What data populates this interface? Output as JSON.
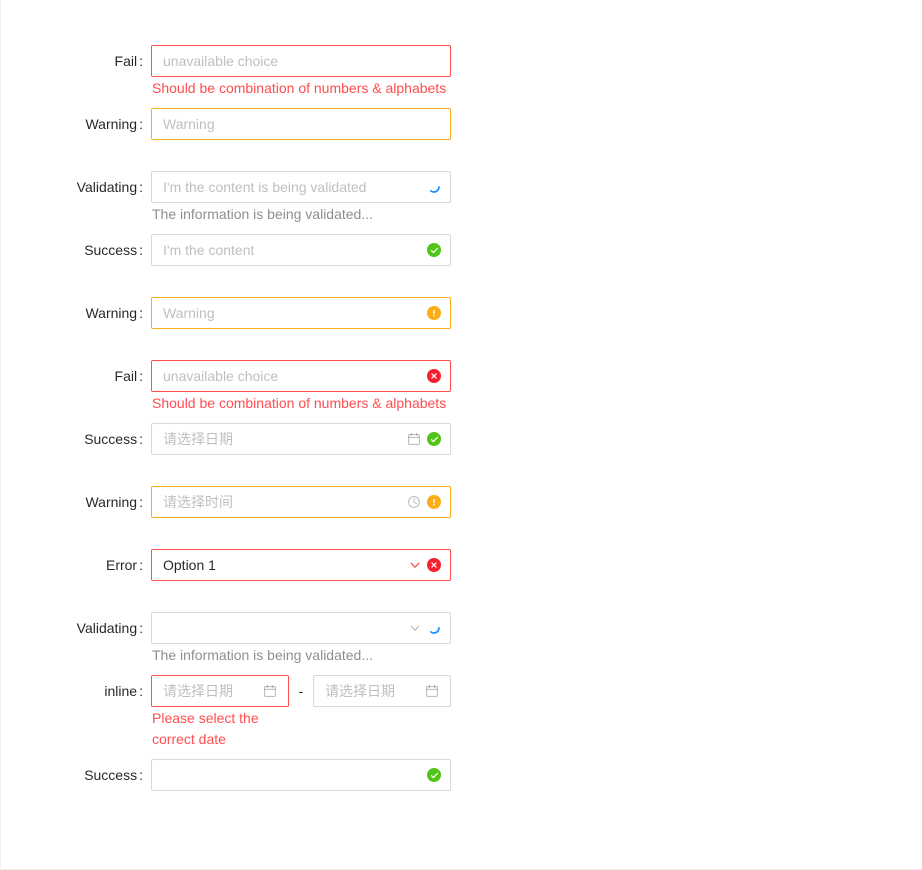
{
  "theme": {
    "error_color": "#ff4d4f",
    "error_icon_color": "#f5222d",
    "warning_color": "#faad14",
    "success_color": "#52c41a",
    "validating_color": "#1890ff",
    "border_color": "#d9d9d9",
    "placeholder_color": "#bfbfbf",
    "label_color": "rgba(0,0,0,0.85)",
    "help_color": "rgba(0,0,0,0.45)"
  },
  "form": {
    "rows": [
      {
        "id": "fail-input-plain",
        "label": "Fail",
        "colon": ":",
        "placeholder": "unavailable choice",
        "value": "",
        "status": "error",
        "help": "Should be combination of numbers & alphabets",
        "help_status": "error",
        "has_status_icon": false,
        "control": "input"
      },
      {
        "id": "warning-input-plain",
        "label": "Warning",
        "colon": ":",
        "placeholder": "Warning",
        "value": "",
        "status": "warning",
        "help": "",
        "has_status_icon": false,
        "control": "input"
      },
      {
        "id": "validating-input",
        "label": "Validating",
        "colon": ":",
        "placeholder": "I'm the content is being validated",
        "value": "",
        "status": "validating",
        "help": "The information is being validated...",
        "help_status": "normal",
        "has_status_icon": true,
        "status_icon": "loading-spinner-icon",
        "control": "input"
      },
      {
        "id": "success-input",
        "label": "Success",
        "colon": ":",
        "placeholder": "I'm the content",
        "value": "",
        "status": "success",
        "help": "",
        "has_status_icon": true,
        "status_icon": "check-circle-icon",
        "control": "input"
      },
      {
        "id": "warning-input-icon",
        "label": "Warning",
        "colon": ":",
        "placeholder": "Warning",
        "value": "",
        "status": "warning",
        "help": "",
        "has_status_icon": true,
        "status_icon": "exclamation-circle-icon",
        "control": "input"
      },
      {
        "id": "fail-input-icon",
        "label": "Fail",
        "colon": ":",
        "placeholder": "unavailable choice",
        "value": "",
        "status": "error",
        "help": "Should be combination of numbers & alphabets",
        "help_status": "error",
        "has_status_icon": true,
        "status_icon": "close-circle-icon",
        "control": "input"
      },
      {
        "id": "success-datepicker",
        "label": "Success",
        "colon": ":",
        "placeholder": "请选择日期",
        "value": "",
        "status": "success",
        "help": "",
        "has_status_icon": true,
        "status_icon": "check-circle-icon",
        "prefix_icon": "calendar-icon",
        "control": "datepicker"
      },
      {
        "id": "warning-timepicker",
        "label": "Warning",
        "colon": ":",
        "placeholder": "请选择时间",
        "value": "",
        "status": "warning",
        "help": "",
        "has_status_icon": true,
        "status_icon": "exclamation-circle-icon",
        "prefix_icon": "clock-icon",
        "control": "timepicker"
      },
      {
        "id": "error-select",
        "label": "Error",
        "colon": ":",
        "placeholder": "",
        "value": "Option 1",
        "status": "error",
        "help": "",
        "has_status_icon": true,
        "status_icon": "close-circle-icon",
        "prefix_icon": "chevron-down-icon",
        "control": "select"
      },
      {
        "id": "validating-select",
        "label": "Validating",
        "colon": ":",
        "placeholder": "",
        "value": "",
        "status": "validating",
        "help": "The information is being validated...",
        "help_status": "normal",
        "has_status_icon": true,
        "status_icon": "loading-spinner-icon",
        "prefix_icon": "chevron-down-icon",
        "control": "select"
      }
    ],
    "inline_row": {
      "id": "inline-date-range",
      "label": "inline",
      "colon": ":",
      "start_placeholder": "请选择日期",
      "start_value": "",
      "start_status": "error",
      "separator": "-",
      "end_placeholder": "请选择日期",
      "end_value": "",
      "end_status": "normal",
      "help_line1": "Please select the",
      "help_line2": "correct date",
      "help_status": "error",
      "icon": "calendar-icon"
    },
    "final_row": {
      "id": "success-empty",
      "label": "Success",
      "colon": ":",
      "placeholder": "",
      "value": "",
      "status": "success",
      "status_icon": "check-circle-icon"
    }
  }
}
